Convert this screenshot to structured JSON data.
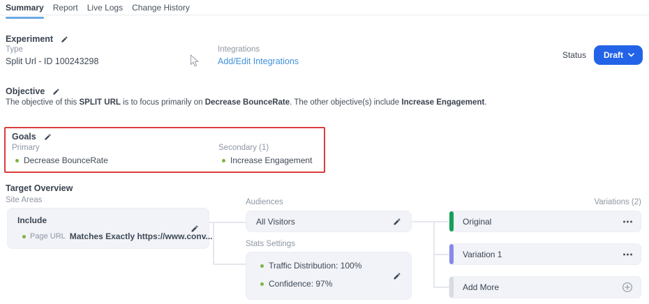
{
  "tabs": [
    {
      "label": "Summary",
      "active": true
    },
    {
      "label": "Report",
      "active": false
    },
    {
      "label": "Live Logs",
      "active": false
    },
    {
      "label": "Change History",
      "active": false
    }
  ],
  "experiment": {
    "heading": "Experiment",
    "type_label": "Type",
    "type_value": "Split Url - ID 100243298",
    "integrations_label": "Integrations",
    "integrations_link": "Add/Edit Integrations",
    "status_label": "Status",
    "status_value": "Draft"
  },
  "objective": {
    "heading": "Objective",
    "p1": "The objective of this ",
    "b1": "SPLIT URL",
    "p2": " is to focus primarily on ",
    "b2": "Decrease BounceRate",
    "p3": ". The other objective(s) include ",
    "b3": "Increase Engagement",
    "p4": "."
  },
  "goals": {
    "heading": "Goals",
    "primary_label": "Primary",
    "primary_goal": "Decrease BounceRate",
    "secondary_label": "Secondary (1)",
    "secondary_goal": "Increase Engagement"
  },
  "target_overview": {
    "heading": "Target Overview",
    "site_areas": {
      "label": "Site Areas",
      "card_title": "Include",
      "condition_prefix": "Page URL",
      "condition_text": "Matches Exactly https://www.conv..."
    },
    "audiences": {
      "label": "Audiences",
      "value": "All Visitors"
    },
    "stats": {
      "label": "Stats Settings",
      "items": [
        "Traffic Distribution: 100%",
        "Confidence: 97%"
      ]
    },
    "variations": {
      "label": "Variations (2)",
      "items": [
        {
          "name": "Original",
          "color": "#15a05a"
        },
        {
          "name": "Variation 1",
          "color": "#8889e9"
        }
      ],
      "add_more_label": "Add More",
      "add_more_color": "#d8dbe2"
    }
  },
  "colors": {
    "accent_button": "#2263e7",
    "link": "#4191d9",
    "tab_underline": "#6aa9e4",
    "goal_dot": "#7cb342",
    "annotation_red": "#dc3c3c",
    "card_bg": "#f1f3f8"
  }
}
